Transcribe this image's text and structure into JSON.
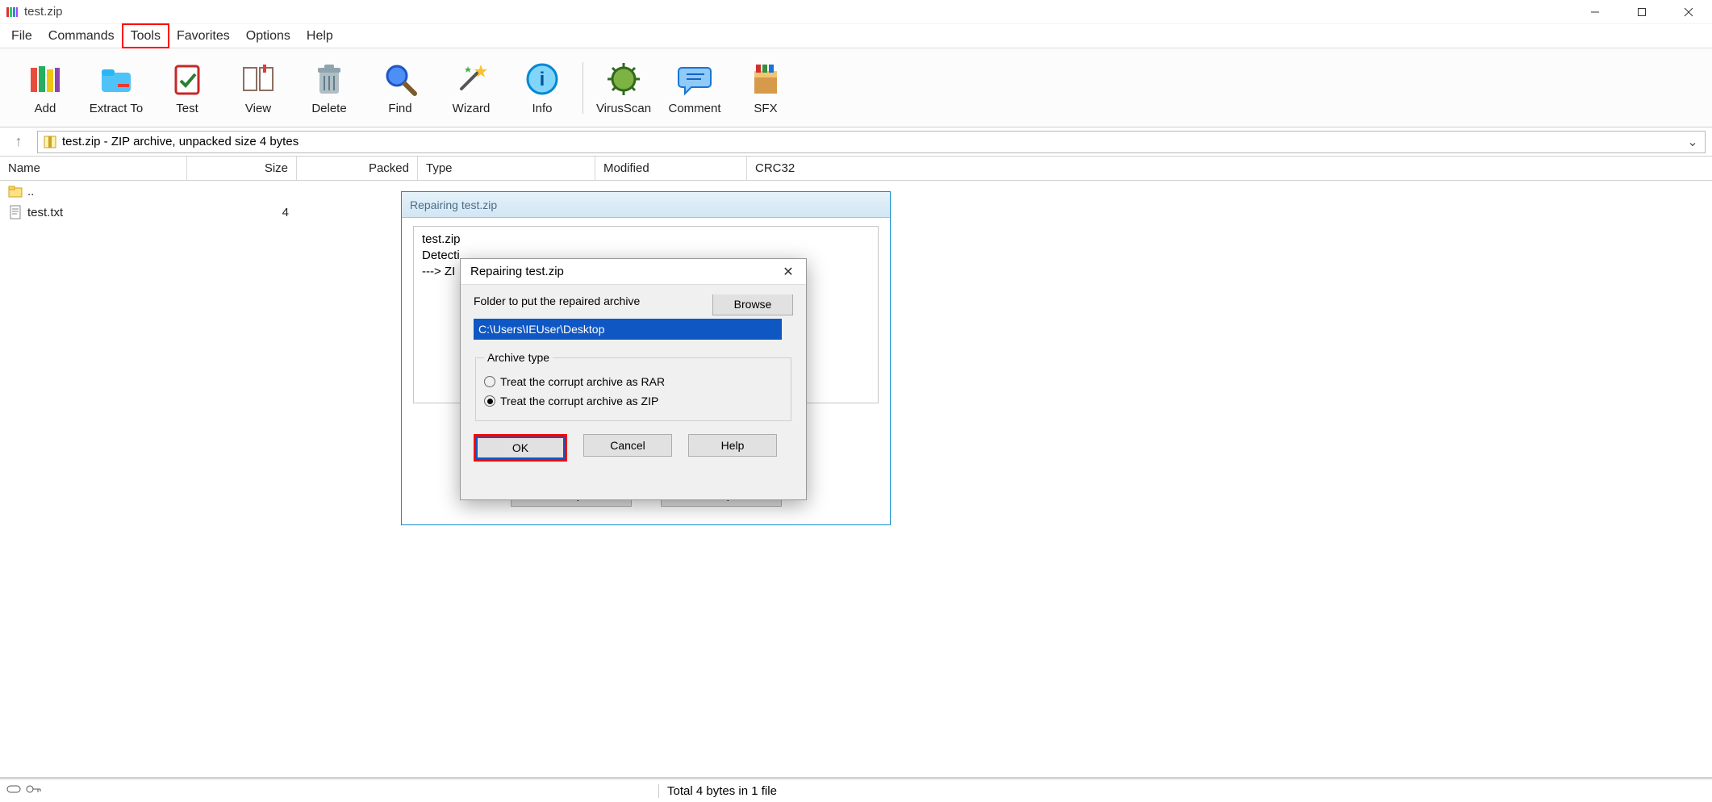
{
  "window": {
    "title": "test.zip",
    "minimize": "–",
    "maximize": "□",
    "close": "×"
  },
  "menu": {
    "file": "File",
    "commands": "Commands",
    "tools": "Tools",
    "favorites": "Favorites",
    "options": "Options",
    "help": "Help"
  },
  "toolbar": {
    "add": "Add",
    "extract": "Extract To",
    "test": "Test",
    "view": "View",
    "delete": "Delete",
    "find": "Find",
    "wizard": "Wizard",
    "info": "Info",
    "virusscan": "VirusScan",
    "comment": "Comment",
    "sfx": "SFX"
  },
  "pathbar": {
    "up_symbol": "↑",
    "text": "test.zip - ZIP archive, unpacked size 4 bytes",
    "dropdown": "⌄"
  },
  "columns": {
    "name": "Name",
    "size": "Size",
    "packed": "Packed",
    "type": "Type",
    "modified": "Modified",
    "crc32": "CRC32"
  },
  "rows": {
    "parent": "..",
    "file_name": "test.txt",
    "file_size": "4"
  },
  "status": {
    "total": "Total 4 bytes in 1 file"
  },
  "back_dialog": {
    "title": "Repairing test.zip",
    "line1": "test.zip",
    "line2": "Detecti",
    "line3": "---> ZI",
    "stop": "Stop",
    "help": "Help"
  },
  "front_dialog": {
    "title": "Repairing test.zip",
    "close": "✕",
    "folder_label": "Folder to put the repaired archive",
    "browse": "Browse",
    "path_value": "C:\\Users\\IEUser\\Desktop",
    "archive_type_legend": "Archive type",
    "radio_rar": "Treat the corrupt archive as RAR",
    "radio_zip": "Treat the corrupt archive as ZIP",
    "ok": "OK",
    "cancel": "Cancel",
    "help": "Help"
  },
  "highlighted": {
    "tools_menu": true,
    "ok_button": true
  }
}
